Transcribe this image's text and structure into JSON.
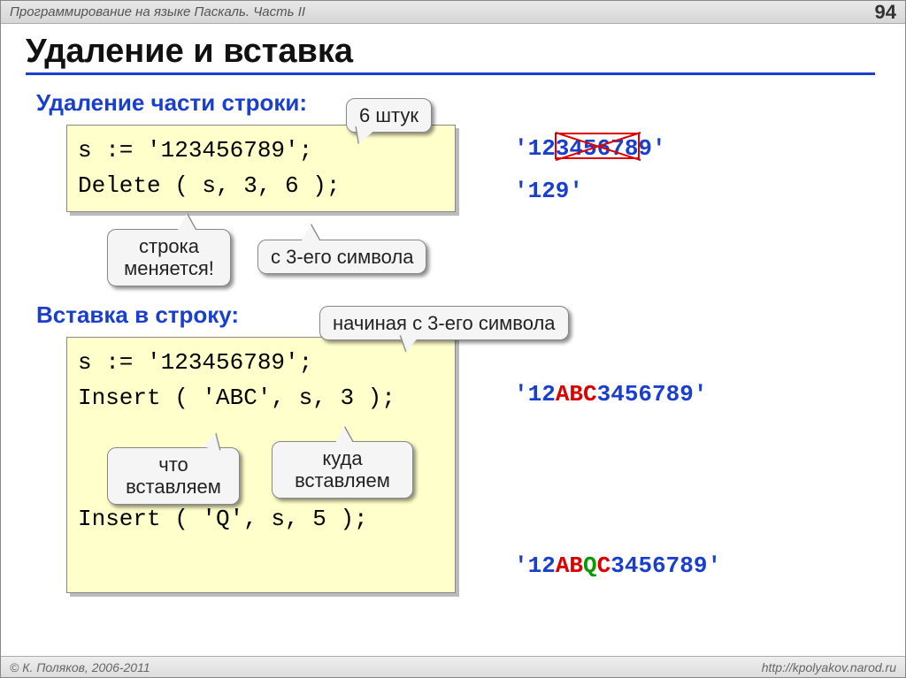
{
  "header": {
    "breadcrumb": "Программирование на языке Паскаль. Часть II",
    "page": "94"
  },
  "title": "Удаление и вставка",
  "section1": {
    "heading": "Удаление части строки:",
    "code": "s := '123456789';\nDelete ( s, 3, 6 );",
    "callout_count": "6 штук",
    "callout_changes": "строка меняется!",
    "callout_from": "с 3-его символа",
    "out1_full": "'123456789'",
    "out2": "'129'"
  },
  "section2": {
    "heading": "Вставка в строку:",
    "code_top": "s := '123456789';\nInsert ( 'ABC', s, 3 );",
    "code_bottom": "Insert ( 'Q', s, 5 );",
    "callout_start": "начиная с 3-его символа",
    "callout_what": "что вставляем",
    "callout_where": "куда вставляем",
    "out1_pre": "'12",
    "out1_ins": "ABC",
    "out1_post": "3456789'",
    "out2_pre": "'12",
    "out2_ab": "AB",
    "out2_q": "Q",
    "out2_c": "C",
    "out2_post": "3456789'"
  },
  "footer": {
    "left": "© К. Поляков, 2006-2011",
    "right": "http://kpolyakov.narod.ru"
  }
}
